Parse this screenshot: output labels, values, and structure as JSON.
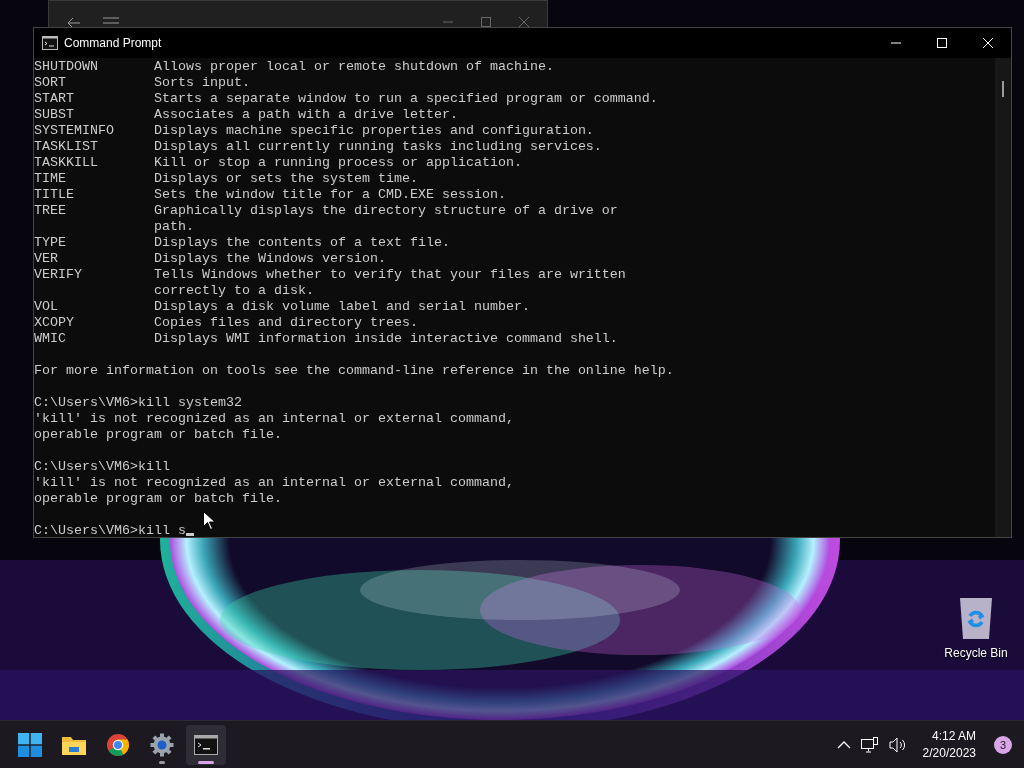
{
  "console_window": {
    "title": "Command Prompt",
    "blocks": [
      [
        "SHUTDOWN       Allows proper local or remote shutdown of machine.",
        "SORT           Sorts input.",
        "START          Starts a separate window to run a specified program or command.",
        "SUBST          Associates a path with a drive letter.",
        "SYSTEMINFO     Displays machine specific properties and configuration.",
        "TASKLIST       Displays all currently running tasks including services.",
        "TASKKILL       Kill or stop a running process or application.",
        "TIME           Displays or sets the system time.",
        "TITLE          Sets the window title for a CMD.EXE session.",
        "TREE           Graphically displays the directory structure of a drive or",
        "               path.",
        "TYPE           Displays the contents of a text file.",
        "VER            Displays the Windows version.",
        "VERIFY         Tells Windows whether to verify that your files are written",
        "               correctly to a disk.",
        "VOL            Displays a disk volume label and serial number.",
        "XCOPY          Copies files and directory trees.",
        "WMIC           Displays WMI information inside interactive command shell."
      ],
      [
        "For more information on tools see the command-line reference in the online help."
      ],
      [
        "C:\\Users\\VM6>kill system32",
        "'kill' is not recognized as an internal or external command,",
        "operable program or batch file."
      ],
      [
        "C:\\Users\\VM6>kill",
        "'kill' is not recognized as an internal or external command,",
        "operable program or batch file."
      ],
      [
        "C:\\Users\\VM6>kill s"
      ]
    ]
  },
  "desktop_icons": [
    {
      "label": "Recycle Bin"
    }
  ],
  "taskbar": {
    "apps": [
      {
        "kind": "start",
        "running": false,
        "selected": false
      },
      {
        "kind": "folder",
        "running": false,
        "selected": false
      },
      {
        "kind": "browser",
        "running": false,
        "selected": false
      },
      {
        "kind": "settings",
        "running": true,
        "selected": false
      },
      {
        "kind": "terminal",
        "running": true,
        "selected": true
      }
    ],
    "clock": {
      "time": "4:12 AM",
      "date": "2/20/2023"
    },
    "notification_count": "3"
  }
}
